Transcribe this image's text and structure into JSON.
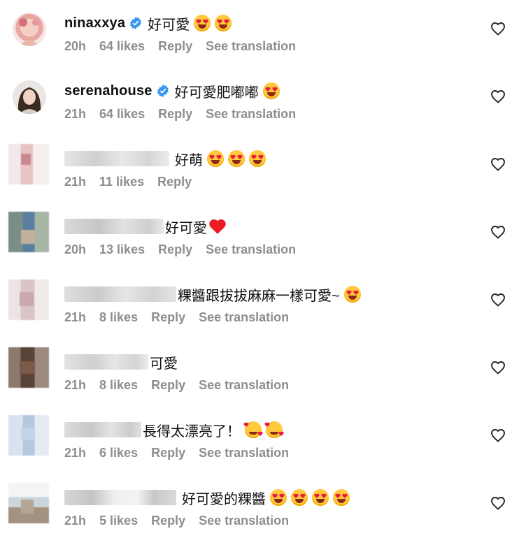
{
  "comments": [
    {
      "username": "ninaxxya",
      "verified": true,
      "text": "好可愛",
      "emojis": [
        "heart-eyes",
        "heart-eyes"
      ],
      "time": "20h",
      "likes": "64 likes",
      "reply": "Reply",
      "translate": "See translation"
    },
    {
      "username": "serenahouse",
      "verified": true,
      "text": "好可愛肥嘟嘟",
      "emojis": [
        "heart-eyes"
      ],
      "time": "21h",
      "likes": "64 likes",
      "reply": "Reply",
      "translate": "See translation"
    },
    {
      "username": "",
      "verified": false,
      "text": "好萌",
      "emojis": [
        "heart-eyes",
        "heart-eyes",
        "heart-eyes"
      ],
      "time": "21h",
      "likes": "11 likes",
      "reply": "Reply",
      "translate": ""
    },
    {
      "username": "",
      "verified": false,
      "text": "好可愛",
      "emojis": [
        "red-heart"
      ],
      "time": "20h",
      "likes": "13 likes",
      "reply": "Reply",
      "translate": "See translation"
    },
    {
      "username": "",
      "verified": false,
      "text": "粿醬跟拔拔麻麻一樣可愛~",
      "emojis": [
        "heart-eyes"
      ],
      "time": "21h",
      "likes": "8 likes",
      "reply": "Reply",
      "translate": "See translation"
    },
    {
      "username": "",
      "verified": false,
      "text": "可愛",
      "emojis": [],
      "time": "21h",
      "likes": "8 likes",
      "reply": "Reply",
      "translate": "See translation"
    },
    {
      "username": "",
      "verified": false,
      "text": "長得太漂亮了！",
      "emojis": [
        "smiling-face-with-hearts",
        "smiling-face-with-hearts"
      ],
      "time": "21h",
      "likes": "6 likes",
      "reply": "Reply",
      "translate": "See translation"
    },
    {
      "username": "",
      "verified": false,
      "text": "好可愛的粿醬",
      "emojis": [
        "heart-eyes",
        "heart-eyes",
        "heart-eyes",
        "heart-eyes"
      ],
      "time": "21h",
      "likes": "5 likes",
      "reply": "Reply",
      "translate": "See translation"
    }
  ],
  "colors": {
    "meta_gray": "#8e8e8e",
    "verified_blue": "#3897f0",
    "emoji_yellow": "#ffc83d",
    "heart_red": "#ed1c24"
  }
}
